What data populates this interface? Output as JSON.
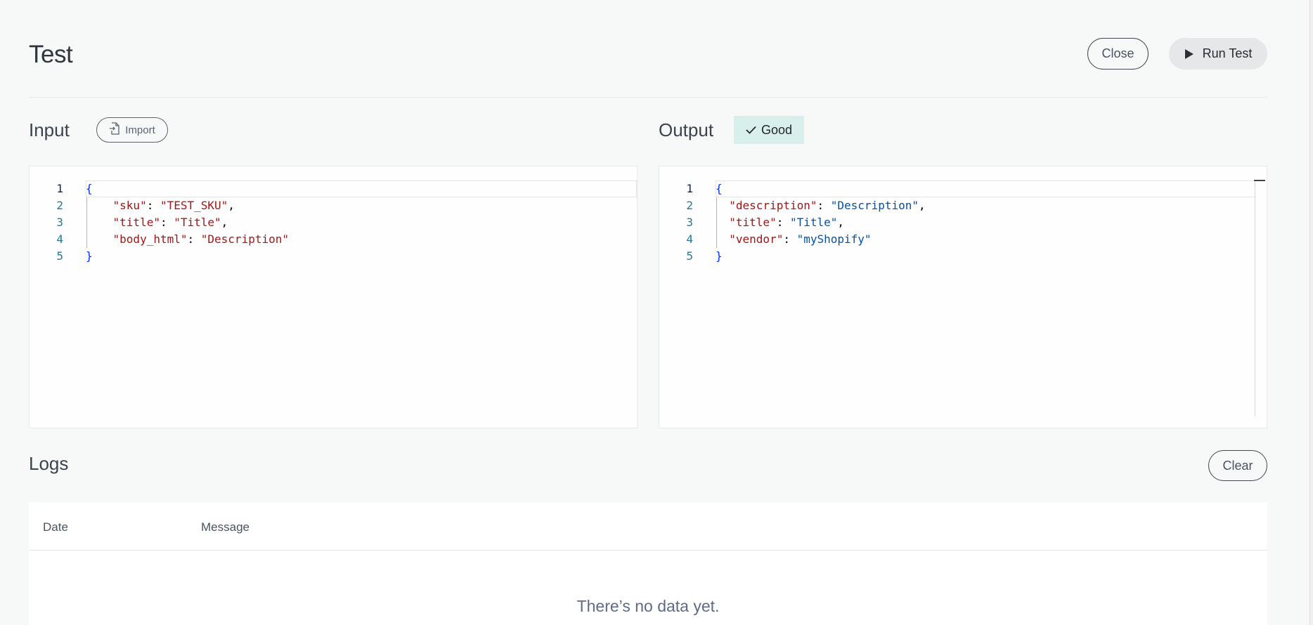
{
  "header": {
    "title": "Test",
    "close_label": "Close",
    "run_label": "Run Test",
    "run_icon": "play-icon"
  },
  "input": {
    "title": "Input",
    "import_label": "Import",
    "import_icon": "file-import-icon",
    "lines": [
      {
        "num": "1",
        "tokens": [
          {
            "t": "{",
            "c": "b"
          }
        ]
      },
      {
        "num": "2",
        "tokens": [
          {
            "t": "    ",
            "c": "p"
          },
          {
            "t": "\"sku\"",
            "c": "k"
          },
          {
            "t": ": ",
            "c": "p"
          },
          {
            "t": "\"TEST_SKU\"",
            "c": "s-in"
          },
          {
            "t": ",",
            "c": "p"
          }
        ]
      },
      {
        "num": "3",
        "tokens": [
          {
            "t": "    ",
            "c": "p"
          },
          {
            "t": "\"title\"",
            "c": "k"
          },
          {
            "t": ": ",
            "c": "p"
          },
          {
            "t": "\"Title\"",
            "c": "s-in"
          },
          {
            "t": ",",
            "c": "p"
          }
        ]
      },
      {
        "num": "4",
        "tokens": [
          {
            "t": "    ",
            "c": "p"
          },
          {
            "t": "\"body_html\"",
            "c": "k"
          },
          {
            "t": ": ",
            "c": "p"
          },
          {
            "t": "\"Description\"",
            "c": "s-in"
          }
        ]
      },
      {
        "num": "5",
        "tokens": [
          {
            "t": "}",
            "c": "b"
          }
        ]
      }
    ]
  },
  "output": {
    "title": "Output",
    "status_label": "Good",
    "status_icon": "check-icon",
    "status_color": "#d9efec",
    "lines": [
      {
        "num": "1",
        "tokens": [
          {
            "t": "{",
            "c": "b"
          }
        ]
      },
      {
        "num": "2",
        "tokens": [
          {
            "t": "  ",
            "c": "p"
          },
          {
            "t": "\"description\"",
            "c": "k"
          },
          {
            "t": ": ",
            "c": "p"
          },
          {
            "t": "\"Description\"",
            "c": "s-out"
          },
          {
            "t": ",",
            "c": "p"
          }
        ]
      },
      {
        "num": "3",
        "tokens": [
          {
            "t": "  ",
            "c": "p"
          },
          {
            "t": "\"title\"",
            "c": "k"
          },
          {
            "t": ": ",
            "c": "p"
          },
          {
            "t": "\"Title\"",
            "c": "s-out"
          },
          {
            "t": ",",
            "c": "p"
          }
        ]
      },
      {
        "num": "4",
        "tokens": [
          {
            "t": "  ",
            "c": "p"
          },
          {
            "t": "\"vendor\"",
            "c": "k"
          },
          {
            "t": ": ",
            "c": "p"
          },
          {
            "t": "\"myShopify\"",
            "c": "s-out"
          }
        ]
      },
      {
        "num": "5",
        "tokens": [
          {
            "t": "}",
            "c": "b"
          }
        ]
      }
    ]
  },
  "logs": {
    "title": "Logs",
    "clear_label": "Clear",
    "columns": [
      "Date",
      "Message"
    ],
    "empty_text": "There’s no data yet."
  }
}
